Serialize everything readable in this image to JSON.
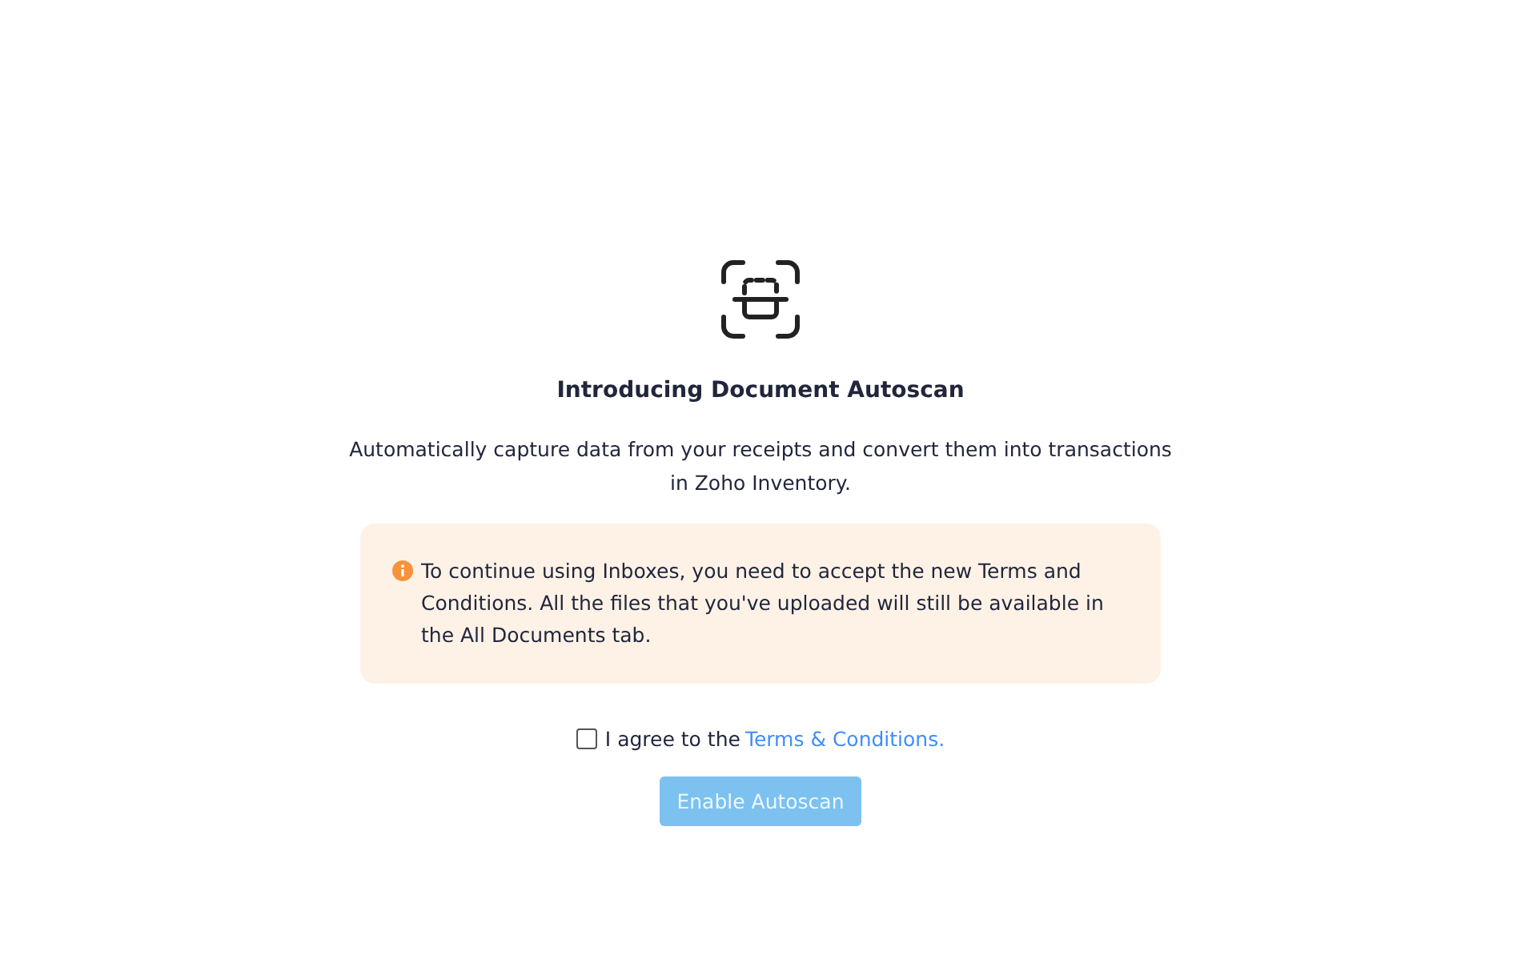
{
  "title": "Introducing Document Autoscan",
  "description": "Automatically capture data from your receipts and convert them into transactions in Zoho Inventory.",
  "notice": {
    "text": "To continue using Inboxes, you need to accept the new Terms and Conditions. All the files that you've uploaded will still be available in the All Documents tab."
  },
  "agreement": {
    "checked": false,
    "label": "I agree to the",
    "link": "Terms & Conditions."
  },
  "button": {
    "label": "Enable Autoscan",
    "disabled": true
  }
}
